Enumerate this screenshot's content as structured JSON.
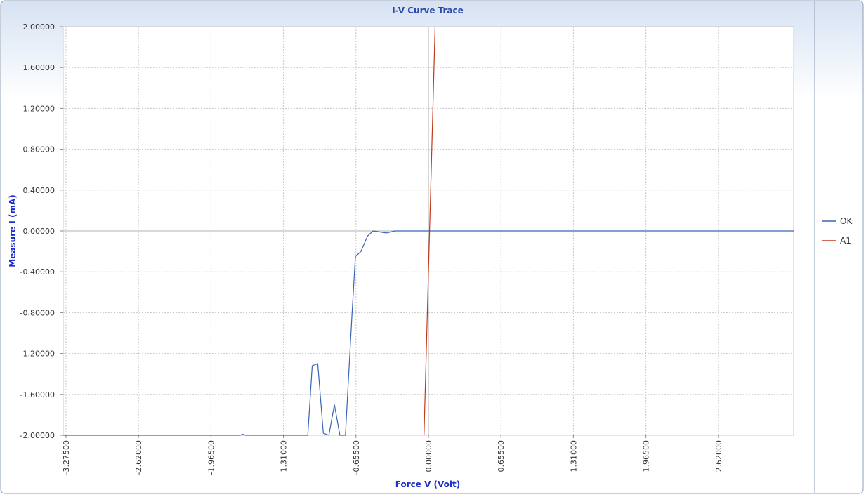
{
  "chart_data": {
    "type": "line",
    "title": "I-V Curve Trace",
    "xlabel": "Force V (Volt)",
    "ylabel": "Measure I (mA)",
    "xlim": [
      -3.3,
      3.3
    ],
    "ylim": [
      -2.0,
      2.0
    ],
    "x_ticks": [
      -3.275,
      -2.62,
      -1.965,
      -1.31,
      -0.655,
      0.0,
      0.655,
      1.31,
      1.965,
      2.62
    ],
    "x_tick_labels": [
      "-3.27500",
      "-2.62000",
      "-1.96500",
      "-1.31000",
      "-0.65500",
      "0.00000",
      "0.65500",
      "1.31000",
      "1.96500",
      "2.62000"
    ],
    "y_ticks": [
      2.0,
      1.6,
      1.2,
      0.8,
      0.4,
      0.0,
      -0.4,
      -0.8,
      -1.2,
      -1.6,
      -2.0
    ],
    "y_tick_labels": [
      "2.00000",
      "1.60000",
      "1.20000",
      "0.80000",
      "0.40000",
      "0.00000",
      "-0.40000",
      "-0.80000",
      "-1.20000",
      "-1.60000",
      "-2.00000"
    ],
    "grid": true,
    "legend_position": "right",
    "series": [
      {
        "name": "OK",
        "color": "#3a64b4",
        "x": [
          -3.3,
          -1.7,
          -1.68,
          -1.65,
          -1.09,
          -1.05,
          -1.0,
          -0.95,
          -0.9,
          -0.85,
          -0.8,
          -0.78,
          -0.75,
          -0.72,
          -0.69,
          -0.66,
          -0.61,
          -0.55,
          -0.5,
          -0.44,
          -0.38,
          -0.3,
          -0.25,
          3.3
        ],
        "y": [
          -2.0,
          -2.0,
          -1.99,
          -2.0,
          -2.0,
          -1.32,
          -1.3,
          -1.98,
          -2.0,
          -1.7,
          -2.0,
          -2.0,
          -2.0,
          -1.4,
          -0.8,
          -0.25,
          -0.2,
          -0.05,
          0.0,
          -0.01,
          -0.02,
          0.0,
          0.0,
          0.0
        ]
      },
      {
        "name": "A1",
        "color": "#c0391b",
        "x": [
          -0.04,
          0.06
        ],
        "y": [
          -2.0,
          2.0
        ]
      }
    ]
  }
}
